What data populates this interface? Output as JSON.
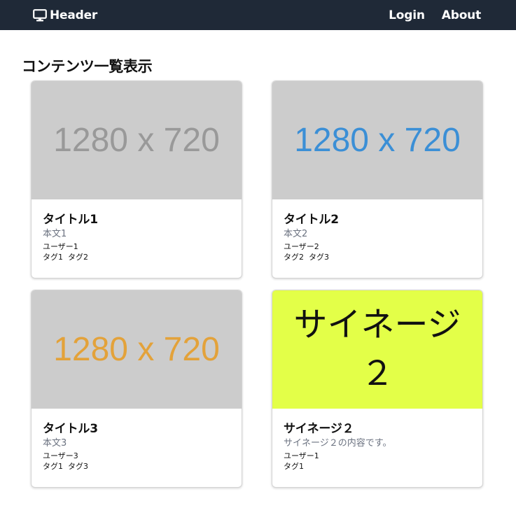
{
  "header": {
    "brand": "Header",
    "brand_icon": "monitor-icon",
    "nav": {
      "login": "Login",
      "about": "About"
    },
    "background": "#1f2937"
  },
  "main": {
    "title": "コンテンツ一覧表示",
    "cards": [
      {
        "image_text": "1280 x 720",
        "image_bg": "#cccccc",
        "image_color": "#999999",
        "title": "タイトル1",
        "body": "本文1",
        "user": "ユーザー1",
        "tags": [
          "タグ1",
          "タグ2"
        ]
      },
      {
        "image_text": "1280 x 720",
        "image_bg": "#cccccc",
        "image_color": "#3b8fd6",
        "title": "タイトル2",
        "body": "本文2",
        "user": "ユーザー2",
        "tags": [
          "タグ2",
          "タグ3"
        ]
      },
      {
        "image_text": "1280 x 720",
        "image_bg": "#cccccc",
        "image_color": "#e3a23a",
        "title": "タイトル3",
        "body": "本文3",
        "user": "ユーザー3",
        "tags": [
          "タグ1",
          "タグ3"
        ]
      },
      {
        "image_text": "サイネージ２",
        "image_bg": "#e3ff48",
        "image_color": "#111111",
        "title": "サイネージ２",
        "body": "サイネージ２の内容です。",
        "user": "ユーザー1",
        "tags": [
          "タグ1"
        ]
      }
    ]
  }
}
